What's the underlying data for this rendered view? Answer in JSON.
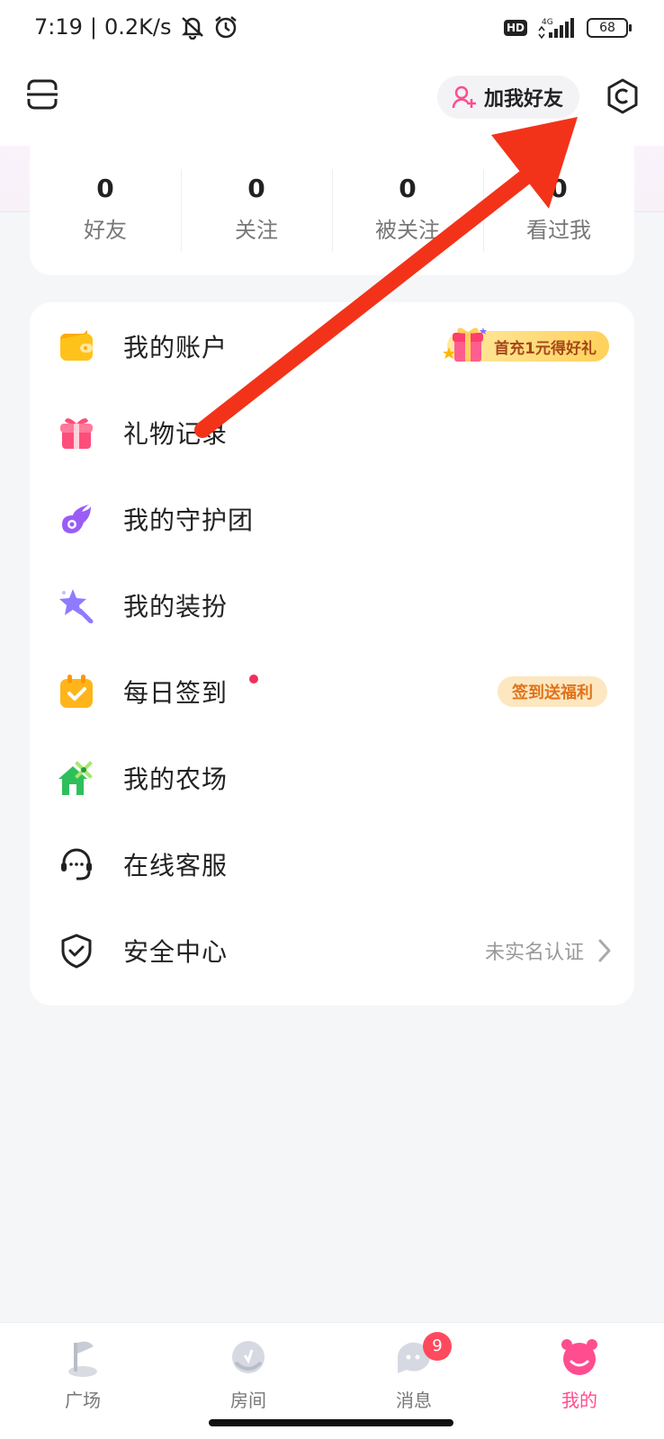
{
  "status_bar": {
    "time": "7:19",
    "network_speed": "0.2K/s",
    "network_type": "4G",
    "hd_label": "HD",
    "battery": "68",
    "icons": [
      "mute-bell-icon",
      "alarm-icon",
      "signal-icon",
      "battery-icon"
    ]
  },
  "header": {
    "add_friend_label": "加我好友",
    "icons": [
      "menu-icon",
      "add-friend-icon",
      "settings-icon"
    ]
  },
  "stats": [
    {
      "value": "0",
      "label": "好友"
    },
    {
      "value": "0",
      "label": "关注"
    },
    {
      "value": "0",
      "label": "被关注"
    },
    {
      "value": "0",
      "label": "看过我"
    }
  ],
  "menu": {
    "items": [
      {
        "label": "我的账户",
        "icon": "wallet-icon",
        "badge": "首充1元得好礼"
      },
      {
        "label": "礼物记录",
        "icon": "gift-icon"
      },
      {
        "label": "我的守护团",
        "icon": "guard-icon"
      },
      {
        "label": "我的装扮",
        "icon": "magic-wand-icon"
      },
      {
        "label": "每日签到",
        "icon": "calendar-icon",
        "badge": "签到送福利",
        "has_dot": true
      },
      {
        "label": "我的农场",
        "icon": "farm-icon"
      },
      {
        "label": "在线客服",
        "icon": "headset-icon"
      },
      {
        "label": "安全中心",
        "icon": "shield-icon",
        "status": "未实名认证"
      }
    ]
  },
  "bottom_nav": {
    "items": [
      {
        "label": "广场",
        "icon": "plaza-icon"
      },
      {
        "label": "房间",
        "icon": "room-icon"
      },
      {
        "label": "消息",
        "icon": "message-icon",
        "badge": "9"
      },
      {
        "label": "我的",
        "icon": "profile-icon",
        "active": true
      }
    ]
  },
  "colors": {
    "accent_pink": "#ff4d8f",
    "annotation_arrow": "#f2331a",
    "background": "#f5f6f8"
  }
}
